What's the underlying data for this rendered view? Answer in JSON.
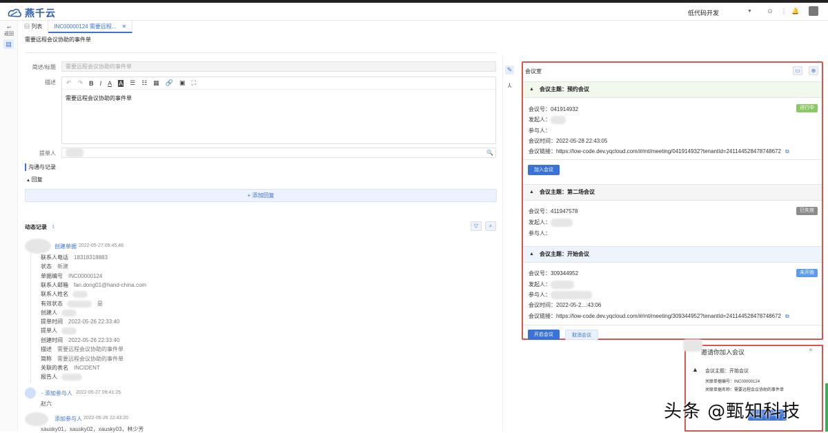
{
  "header": {
    "logo_text": "燕千云",
    "app_name": "低代码开发"
  },
  "leftbar": {
    "back_label": "返回"
  },
  "tabs": [
    {
      "label": "列表"
    },
    {
      "label": "INC00000124 需要远程..."
    }
  ],
  "page": {
    "title": "需要远程会议协助的事件单"
  },
  "form": {
    "subject_label": "简述/标题",
    "subject_value": "需要远程会议协助的事件单",
    "desc_label": "描述",
    "desc_value": "需要远程会议协助的事件单",
    "submitter_label": "提单人"
  },
  "comm": {
    "section_title": "沟通与记录",
    "reply_label": "回复",
    "add_reply_label": "添加回复"
  },
  "activity": {
    "title": "动态记录",
    "entries": [
      {
        "action": "创建单据",
        "time": "2022-05-27 09:45:46"
      },
      {
        "action": "添加参与人",
        "time": "2022-05-27 09:41:26",
        "detail": "赵六"
      },
      {
        "action": "添加参与人",
        "time": "2022-05-26 22:43:20",
        "detail": "xausky01，xausky02，xausky03，林少芳"
      }
    ],
    "fields": [
      {
        "label": "联系人电话",
        "value": "18318318883"
      },
      {
        "label": "状态",
        "value": "新建"
      },
      {
        "label": "单据编号",
        "value": "INC00000124"
      },
      {
        "label": "联系人邮箱",
        "value": "fan.dong01@hand-china.com"
      },
      {
        "label": "联系人姓名",
        "value": ""
      },
      {
        "label": "有效状态",
        "value": "是"
      },
      {
        "label": "创建人",
        "value": ""
      },
      {
        "label": "提单时间",
        "value": "2022-05-26 22:33:40"
      },
      {
        "label": "提单人",
        "value": ""
      },
      {
        "label": "创建时间",
        "value": "2022-05-26 22:33:40"
      },
      {
        "label": "描述",
        "value": "需要远程会议协助的事件单"
      },
      {
        "label": "简称",
        "value": "需要远程会议协助的事件单"
      },
      {
        "label": "关联的表名",
        "value": "INCIDENT"
      },
      {
        "label": "报告人",
        "value": ""
      }
    ]
  },
  "meetings": {
    "title": "会议室",
    "list": [
      {
        "topic": "会议主题：预约会议",
        "no_label": "会议号：",
        "no": "041914932",
        "initiator_label": "发起人：",
        "participant_label": "参与人：",
        "time_label": "会议时间：",
        "time": "2022-05-28 22:43:05",
        "link_label": "会议链接：",
        "link": "https://low-code.dev.yqcloud.com/#/mt/meeting/041914932?tenantId=241144528478748672",
        "status": "进行中",
        "status_color": "#8bc866",
        "button": "加入会议"
      },
      {
        "topic": "会议主题：第二场会议",
        "no_label": "会议号：",
        "no": "411947578",
        "initiator_label": "发起人：",
        "participant_label": "参与人：",
        "status": "已失效",
        "status_color": "#8c8c8c"
      },
      {
        "topic": "会议主题：开始会议",
        "no_label": "会议号：",
        "no": "309344952",
        "initiator_label": "发起人：",
        "participant_label": "参与人：",
        "time_label": "会议时间：",
        "time": "2022-05-2...:43:06",
        "link_label": "会议链接：",
        "link": "https://low-code.dev.yqcloud.com/#/mt/meeting/309344952?tenantId=241144528478748672",
        "status": "未开始",
        "status_color": "#5b9cf0",
        "button_start": "开启会议",
        "button_cancel": "取消会议"
      }
    ]
  },
  "invite": {
    "title": "邀请你加入会议",
    "topic": "会议主题：开始会议",
    "ticket_no": "关联单据编号：INC00000124",
    "ticket_name": "关联单据名称：需要远程会议协助的事件单"
  },
  "watermark": "头条 @甄知科技",
  "colors": {
    "accent": "#3a72d8",
    "highlight_border": "#d9534f"
  }
}
